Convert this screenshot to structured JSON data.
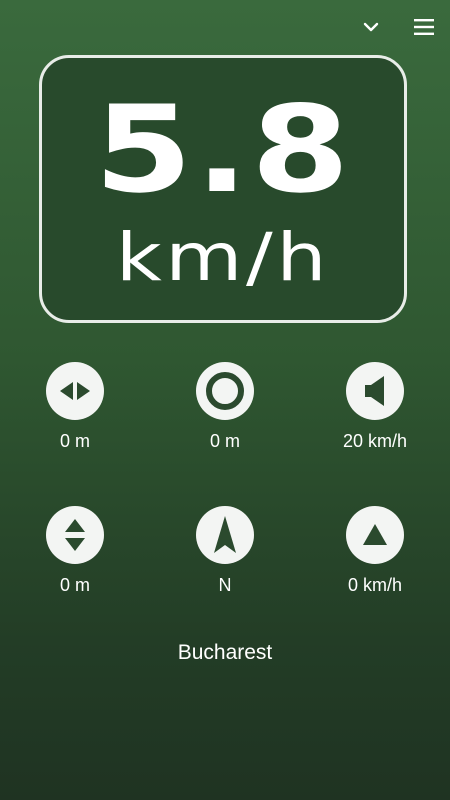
{
  "header": {
    "collapse_icon": "chevron-down-icon",
    "menu_icon": "hamburger-menu-icon"
  },
  "speedometer": {
    "value": "5.8",
    "unit": "km/h"
  },
  "stats": [
    {
      "icon": "horizontal-distance-icon",
      "value": "0 m"
    },
    {
      "icon": "target-icon",
      "value": "0 m"
    },
    {
      "icon": "speaker-icon",
      "value": "20 km/h"
    },
    {
      "icon": "vertical-distance-icon",
      "value": "0 m"
    },
    {
      "icon": "compass-icon",
      "value": "N"
    },
    {
      "icon": "max-speed-icon",
      "value": "0 km/h"
    }
  ],
  "location": {
    "city": "Bucharest"
  },
  "colors": {
    "background_top": "#3a6a3d",
    "background_bottom": "#1f3322",
    "panel": "#284a2c",
    "icon_circle": "#f3f5f3",
    "icon_glyph": "#2b4a2e"
  }
}
